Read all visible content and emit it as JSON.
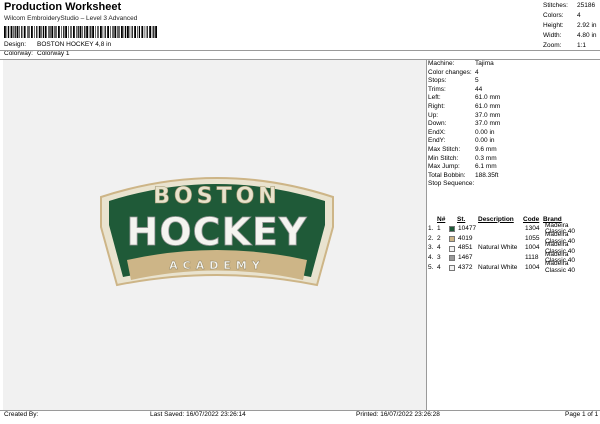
{
  "header": {
    "title": "Production Worksheet",
    "subtitle": "Wilcom EmbroideryStudio – Level 3 Advanced"
  },
  "design": {
    "design_label": "Design:",
    "design_value": "BOSTON HOCKEY 4,8 in",
    "colorway_label": "Colorway:",
    "colorway_value": "Colorway 1"
  },
  "summary": [
    {
      "label": "Stitches:",
      "value": "25186"
    },
    {
      "label": "Colors:",
      "value": "4"
    },
    {
      "label": "Height:",
      "value": "2.92 in"
    },
    {
      "label": "Width:",
      "value": "4.80 in"
    },
    {
      "label": "Zoom:",
      "value": "1:1"
    }
  ],
  "machine_info": [
    {
      "label": "Machine:",
      "value": "Tajima"
    },
    {
      "label": "Color changes:",
      "value": "4"
    },
    {
      "label": "Stops:",
      "value": "5"
    },
    {
      "label": "Trims:",
      "value": "44"
    },
    {
      "label": "Left:",
      "value": "61.0 mm"
    },
    {
      "label": "Right:",
      "value": "61.0 mm"
    },
    {
      "label": "Up:",
      "value": "37.0 mm"
    },
    {
      "label": "Down:",
      "value": "37.0 mm"
    },
    {
      "label": "EndX:",
      "value": "0.00 in"
    },
    {
      "label": "EndY:",
      "value": "0.00 in"
    },
    {
      "label": "Max Stitch:",
      "value": "9.6 mm"
    },
    {
      "label": "Min Stitch:",
      "value": "0.3 mm"
    },
    {
      "label": "Max Jump:",
      "value": "6.1 mm"
    },
    {
      "label": "Total Bobbin:",
      "value": "188.35ft"
    }
  ],
  "stop_sequence": {
    "title": "Stop Sequence:",
    "headers": {
      "no": "N#",
      "st": "St.",
      "desc": "Description",
      "code": "Code",
      "brand": "Brand"
    },
    "rows": [
      {
        "idx": "1.",
        "no": "1",
        "color": "#1f5a38",
        "st": "10477",
        "desc": "",
        "code": "1304",
        "brand": "Madeira Classic 40"
      },
      {
        "idx": "2.",
        "no": "2",
        "color": "#cdb587",
        "st": "4019",
        "desc": "",
        "code": "1055",
        "brand": "Madeira Classic 40"
      },
      {
        "idx": "3.",
        "no": "4",
        "color": "#f2f2f2",
        "st": "4851",
        "desc": "Natural White",
        "code": "1004",
        "brand": "Madeira Classic 40"
      },
      {
        "idx": "4.",
        "no": "3",
        "color": "#9a9a9a",
        "st": "1467",
        "desc": "",
        "code": "1118",
        "brand": "Madeira Classic 40"
      },
      {
        "idx": "5.",
        "no": "4",
        "color": "#f2f2f2",
        "st": "4372",
        "desc": "Natural White",
        "code": "1004",
        "brand": "Madeira Classic 40"
      }
    ]
  },
  "logo": {
    "line1": "BOSTON",
    "line2": "HOCKEY",
    "line3": "ACADEMY"
  },
  "colors": {
    "green": "#1f5a38",
    "tan": "#cdb587",
    "white": "#f4f4f0",
    "canvas": "#f1f1f1"
  },
  "footer": {
    "created_by": "Created By:",
    "last_saved": "Last Saved: 16/07/2022 23:26:14",
    "printed": "Printed: 16/07/2022 23:26:28",
    "page": "Page 1 of 1"
  }
}
